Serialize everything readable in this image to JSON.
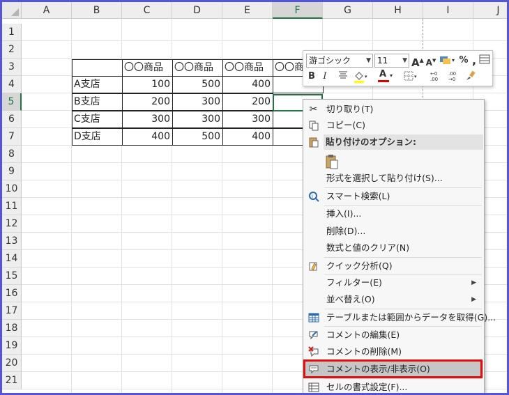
{
  "columns": [
    "A",
    "B",
    "C",
    "D",
    "E",
    "F",
    "G",
    "H",
    "I",
    "J"
  ],
  "selected_column": "F",
  "rows": [
    "1",
    "2",
    "3",
    "4",
    "5",
    "6",
    "7",
    "8",
    "9",
    "10",
    "11",
    "12",
    "13",
    "14",
    "15",
    "16",
    "17",
    "18",
    "19",
    "20",
    "21"
  ],
  "selected_row": "5",
  "table": {
    "headers": [
      "〇〇商品",
      "〇〇商品",
      "〇〇商品",
      "〇〇商"
    ],
    "branches": [
      "A支店",
      "B支店",
      "C支店",
      "D支店"
    ],
    "values": [
      [
        "100",
        "500",
        "400"
      ],
      [
        "200",
        "300",
        "200"
      ],
      [
        "300",
        "300",
        "300"
      ],
      [
        "400",
        "500",
        "400"
      ]
    ]
  },
  "mini_toolbar": {
    "font_name": "游ゴシック",
    "font_size": "11",
    "grow_font": "A",
    "shrink_font": "A",
    "percent": "%",
    "comma": ",",
    "bold": "B",
    "italic": "I",
    "font_color": "A",
    "fill_color": "#ffff00",
    "font_color_value": "#e00000"
  },
  "context_menu": {
    "cut": "切り取り(T)",
    "copy": "コピー(C)",
    "paste_options": "貼り付けのオプション:",
    "paste_special": "形式を選択して貼り付け(S)...",
    "smart_lookup": "スマート検索(L)",
    "insert": "挿入(I)...",
    "delete": "削除(D)...",
    "clear_contents": "数式と値のクリア(N)",
    "quick_analysis": "クイック分析(Q)",
    "filter": "フィルター(E)",
    "sort": "並べ替え(O)",
    "get_data": "テーブルまたは範囲からデータを取得(G)...",
    "edit_comment": "コメントの編集(E)",
    "delete_comment": "コメントの削除(M)",
    "show_hide_comments": "コメントの表示/非表示(O)",
    "format_cells": "セルの書式設定(F)..."
  },
  "colors": {
    "accent": "#217346",
    "highlight_box": "#e01010",
    "frame": "#5555d8"
  }
}
